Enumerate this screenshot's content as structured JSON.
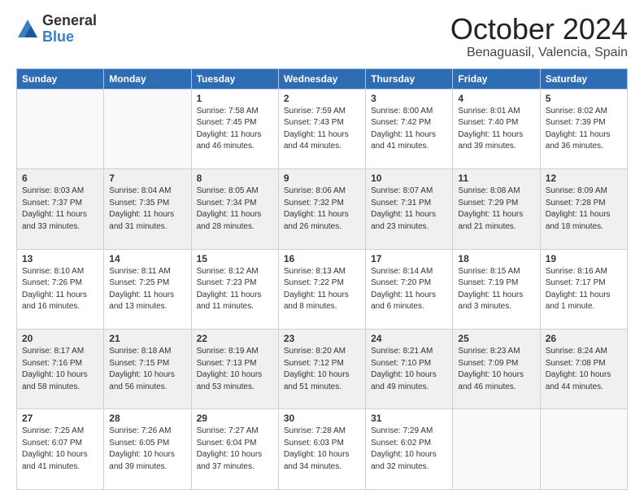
{
  "header": {
    "logo_general": "General",
    "logo_blue": "Blue",
    "month": "October 2024",
    "location": "Benaguasil, Valencia, Spain"
  },
  "weekdays": [
    "Sunday",
    "Monday",
    "Tuesday",
    "Wednesday",
    "Thursday",
    "Friday",
    "Saturday"
  ],
  "weeks": [
    [
      {
        "day": "",
        "info": ""
      },
      {
        "day": "",
        "info": ""
      },
      {
        "day": "1",
        "info": "Sunrise: 7:58 AM\nSunset: 7:45 PM\nDaylight: 11 hours and 46 minutes."
      },
      {
        "day": "2",
        "info": "Sunrise: 7:59 AM\nSunset: 7:43 PM\nDaylight: 11 hours and 44 minutes."
      },
      {
        "day": "3",
        "info": "Sunrise: 8:00 AM\nSunset: 7:42 PM\nDaylight: 11 hours and 41 minutes."
      },
      {
        "day": "4",
        "info": "Sunrise: 8:01 AM\nSunset: 7:40 PM\nDaylight: 11 hours and 39 minutes."
      },
      {
        "day": "5",
        "info": "Sunrise: 8:02 AM\nSunset: 7:39 PM\nDaylight: 11 hours and 36 minutes."
      }
    ],
    [
      {
        "day": "6",
        "info": "Sunrise: 8:03 AM\nSunset: 7:37 PM\nDaylight: 11 hours and 33 minutes."
      },
      {
        "day": "7",
        "info": "Sunrise: 8:04 AM\nSunset: 7:35 PM\nDaylight: 11 hours and 31 minutes."
      },
      {
        "day": "8",
        "info": "Sunrise: 8:05 AM\nSunset: 7:34 PM\nDaylight: 11 hours and 28 minutes."
      },
      {
        "day": "9",
        "info": "Sunrise: 8:06 AM\nSunset: 7:32 PM\nDaylight: 11 hours and 26 minutes."
      },
      {
        "day": "10",
        "info": "Sunrise: 8:07 AM\nSunset: 7:31 PM\nDaylight: 11 hours and 23 minutes."
      },
      {
        "day": "11",
        "info": "Sunrise: 8:08 AM\nSunset: 7:29 PM\nDaylight: 11 hours and 21 minutes."
      },
      {
        "day": "12",
        "info": "Sunrise: 8:09 AM\nSunset: 7:28 PM\nDaylight: 11 hours and 18 minutes."
      }
    ],
    [
      {
        "day": "13",
        "info": "Sunrise: 8:10 AM\nSunset: 7:26 PM\nDaylight: 11 hours and 16 minutes."
      },
      {
        "day": "14",
        "info": "Sunrise: 8:11 AM\nSunset: 7:25 PM\nDaylight: 11 hours and 13 minutes."
      },
      {
        "day": "15",
        "info": "Sunrise: 8:12 AM\nSunset: 7:23 PM\nDaylight: 11 hours and 11 minutes."
      },
      {
        "day": "16",
        "info": "Sunrise: 8:13 AM\nSunset: 7:22 PM\nDaylight: 11 hours and 8 minutes."
      },
      {
        "day": "17",
        "info": "Sunrise: 8:14 AM\nSunset: 7:20 PM\nDaylight: 11 hours and 6 minutes."
      },
      {
        "day": "18",
        "info": "Sunrise: 8:15 AM\nSunset: 7:19 PM\nDaylight: 11 hours and 3 minutes."
      },
      {
        "day": "19",
        "info": "Sunrise: 8:16 AM\nSunset: 7:17 PM\nDaylight: 11 hours and 1 minute."
      }
    ],
    [
      {
        "day": "20",
        "info": "Sunrise: 8:17 AM\nSunset: 7:16 PM\nDaylight: 10 hours and 58 minutes."
      },
      {
        "day": "21",
        "info": "Sunrise: 8:18 AM\nSunset: 7:15 PM\nDaylight: 10 hours and 56 minutes."
      },
      {
        "day": "22",
        "info": "Sunrise: 8:19 AM\nSunset: 7:13 PM\nDaylight: 10 hours and 53 minutes."
      },
      {
        "day": "23",
        "info": "Sunrise: 8:20 AM\nSunset: 7:12 PM\nDaylight: 10 hours and 51 minutes."
      },
      {
        "day": "24",
        "info": "Sunrise: 8:21 AM\nSunset: 7:10 PM\nDaylight: 10 hours and 49 minutes."
      },
      {
        "day": "25",
        "info": "Sunrise: 8:23 AM\nSunset: 7:09 PM\nDaylight: 10 hours and 46 minutes."
      },
      {
        "day": "26",
        "info": "Sunrise: 8:24 AM\nSunset: 7:08 PM\nDaylight: 10 hours and 44 minutes."
      }
    ],
    [
      {
        "day": "27",
        "info": "Sunrise: 7:25 AM\nSunset: 6:07 PM\nDaylight: 10 hours and 41 minutes."
      },
      {
        "day": "28",
        "info": "Sunrise: 7:26 AM\nSunset: 6:05 PM\nDaylight: 10 hours and 39 minutes."
      },
      {
        "day": "29",
        "info": "Sunrise: 7:27 AM\nSunset: 6:04 PM\nDaylight: 10 hours and 37 minutes."
      },
      {
        "day": "30",
        "info": "Sunrise: 7:28 AM\nSunset: 6:03 PM\nDaylight: 10 hours and 34 minutes."
      },
      {
        "day": "31",
        "info": "Sunrise: 7:29 AM\nSunset: 6:02 PM\nDaylight: 10 hours and 32 minutes."
      },
      {
        "day": "",
        "info": ""
      },
      {
        "day": "",
        "info": ""
      }
    ]
  ]
}
